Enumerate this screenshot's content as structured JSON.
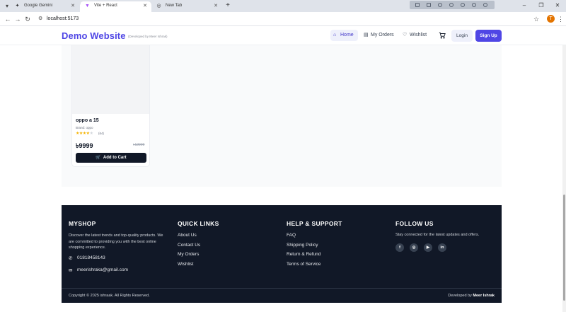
{
  "browser": {
    "tabs": [
      {
        "title": "Google Gemini",
        "favicon": "gemini-icon"
      },
      {
        "title": "Vite + React",
        "favicon": "vite-icon",
        "active": true
      },
      {
        "title": "New Tab",
        "favicon": "globe-icon"
      }
    ],
    "url": "localhost:5173",
    "profile_initial": "T"
  },
  "header": {
    "logo": "Demo Website",
    "logo_sub": "(Developed by Meer Ishrak)",
    "nav": {
      "home": "Home",
      "orders": "My Orders",
      "wishlist": "Wishlist"
    },
    "login": "Login",
    "signup": "Sign Up",
    "accent": "#4f46e5"
  },
  "product": {
    "title": "oppo a 15",
    "brand": "Brand: oppo",
    "rating": 4,
    "rating_max": 5,
    "reviews": "(64)",
    "price": "৳9999",
    "old_price": "৳12999",
    "add_to_cart": "Add to Cart"
  },
  "footer": {
    "shop": {
      "heading": "MYSHOP",
      "text": "Discover the latest trends and top-quality products. We are committed to providing you with the best online shopping experience.",
      "phone": "01818458143",
      "email": "meerishraka@gmail.com"
    },
    "quick_links": {
      "heading": "QUICK LINKS",
      "items": [
        "About Us",
        "Contact Us",
        "My Orders",
        "Wishlist"
      ]
    },
    "help": {
      "heading": "HELP & SUPPORT",
      "items": [
        "FAQ",
        "Shipping Policy",
        "Return & Refund",
        "Terms of Service"
      ]
    },
    "follow": {
      "heading": "FOLLOW US",
      "text": "Stay connected for the latest updates and offers.",
      "socials": [
        "facebook-icon",
        "instagram-icon",
        "youtube-icon",
        "linkedin-icon"
      ]
    },
    "copyright": "Copyright © 2025 ishraak. All Rights Reserved.",
    "developed_prefix": "Developed by",
    "developer": "Meer Ishrak"
  }
}
